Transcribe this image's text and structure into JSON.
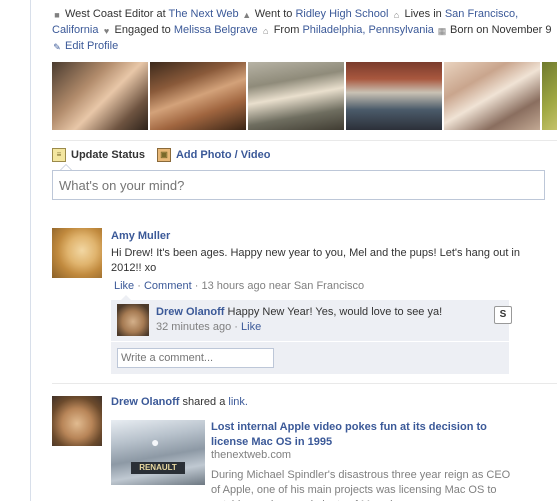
{
  "profile_info": {
    "work_prefix": "West Coast Editor at",
    "work_place": "The Next Web",
    "school_prefix": "Went to",
    "school": "Ridley High School",
    "lives_prefix": "Lives in",
    "lives": "San Francisco, California",
    "engaged_prefix": "Engaged to",
    "engaged_to": "Melissa Belgrave",
    "from_prefix": "From",
    "from": "Philadelphia, Pennsylvania",
    "born": "Born on November 9",
    "edit_profile": "Edit Profile"
  },
  "publisher": {
    "update_status": "Update Status",
    "add_photo": "Add Photo / Video",
    "placeholder": "What's on your mind?"
  },
  "story1": {
    "author": "Amy Muller",
    "message": "Hi Drew! It's been ages. Happy new year to you, Mel and the pups! Let's hang out in 2012!! xo",
    "like": "Like",
    "comment": "Comment",
    "time": "13 hours ago",
    "near": "near San Francisco",
    "reply": {
      "author": "Drew Olanoff",
      "text": "Happy New Year! Yes, would love to see ya!",
      "time": "32 minutes ago",
      "like": "Like"
    },
    "write_placeholder": "Write a comment...",
    "side_label": "S"
  },
  "story2": {
    "author": "Drew Olanoff",
    "shared": "shared a",
    "link_word": "link.",
    "title": "Lost internal Apple video pokes fun at its decision to license Mac OS in 1995",
    "domain": "thenextweb.com",
    "description": "During Michael Spindler's disastrous three year reign as CEO of Apple, one of his main projects was licensing Mac OS to outside vendors, and plenty of Mac clones",
    "plate_text": "RENAULT"
  }
}
